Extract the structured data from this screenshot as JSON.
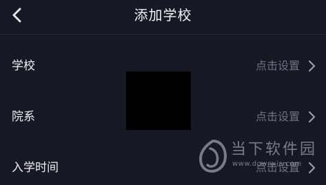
{
  "header": {
    "title": "添加学校",
    "back_icon": "chevron-left-icon"
  },
  "form": {
    "rows": [
      {
        "label": "学校",
        "value": "点击设置",
        "icon": "chevron-right-icon"
      },
      {
        "label": "院系",
        "value": "点击设置",
        "icon": "chevron-right-icon"
      },
      {
        "label": "入学时间",
        "value": "点击设置",
        "icon": "chevron-right-icon"
      }
    ]
  },
  "watermark": {
    "text": "当下软件园",
    "url": "www.downxia.com"
  },
  "colors": {
    "background": "#161824",
    "text_primary": "#eeeef1",
    "text_secondary": "#6f7280"
  }
}
